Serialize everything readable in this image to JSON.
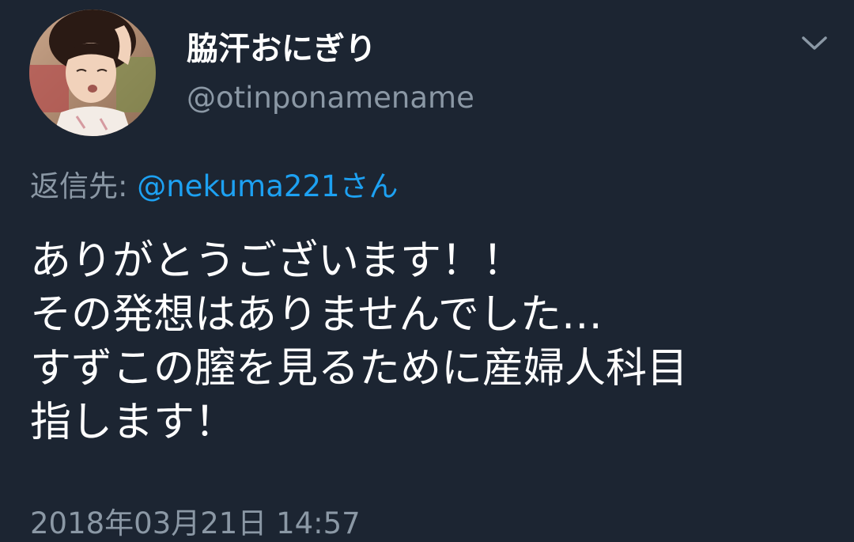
{
  "tweet": {
    "author": {
      "display_name": "脇汗おにぎり",
      "handle": "@otinponamename",
      "avatar_icon": "user-avatar-photo"
    },
    "menu_icon": "chevron-down-icon",
    "reply_to": {
      "prefix": "返信先: ",
      "mention": "@nekuma221さん"
    },
    "text_lines": [
      "ありがとうございます！！",
      "その発想はありませんでした…",
      "すずこの膣を見るために産婦人科目",
      "指します！"
    ],
    "timestamp": "2018年03月21日 14:57"
  },
  "colors": {
    "background": "#1c2532",
    "primary_text": "#ffffff",
    "secondary_text": "#8b98a5",
    "link": "#1da1f2"
  }
}
